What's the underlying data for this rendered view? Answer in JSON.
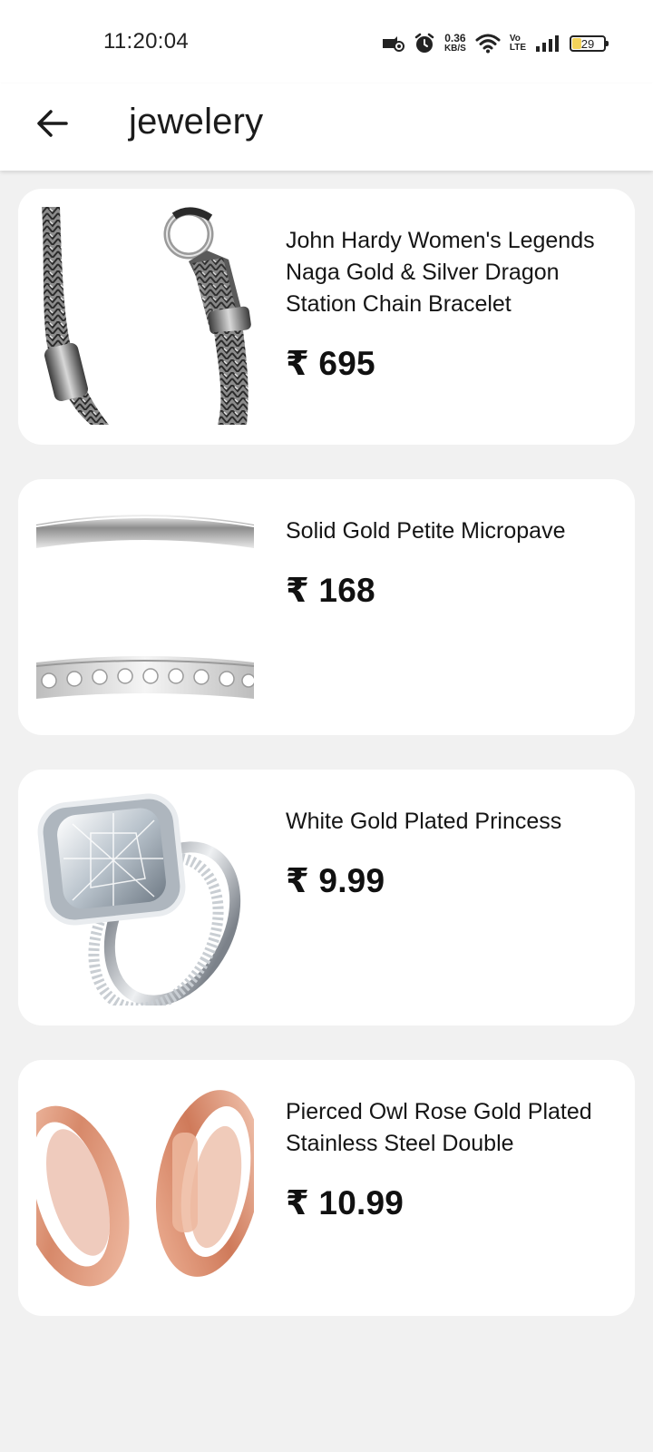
{
  "status_bar": {
    "time": "11:20:04",
    "net_speed_value": "0.36",
    "net_speed_unit": "KB/S",
    "volte_top": "Vo",
    "volte_bottom": "LTE",
    "battery_level": "29",
    "icons": [
      "screen-record-icon",
      "alarm-icon",
      "wifi-icon",
      "signal-icon",
      "battery-icon"
    ]
  },
  "app_bar": {
    "title": "jewelery",
    "back_icon": "arrow-left-icon"
  },
  "currency_symbol": "₹",
  "products": [
    {
      "title": "John Hardy Women's Legends Naga Gold & Silver Dragon Station Chain Bracelet",
      "price": "₹ 695",
      "image": "silver-chain-bracelet"
    },
    {
      "title": "Solid Gold Petite Micropave",
      "price": "₹ 168",
      "image": "silver-band-ring"
    },
    {
      "title": "White Gold Plated Princess",
      "price": "₹ 9.99",
      "image": "diamond-engagement-ring"
    },
    {
      "title": "Pierced Owl Rose Gold Plated Stainless Steel Double",
      "price": "₹ 10.99",
      "image": "rose-gold-tunnel-plugs"
    }
  ],
  "colors": {
    "background": "#f1f1f1",
    "card": "#ffffff",
    "text": "#111111",
    "battery_fill": "#f3d35b",
    "rose_gold": "#e8a58a"
  }
}
